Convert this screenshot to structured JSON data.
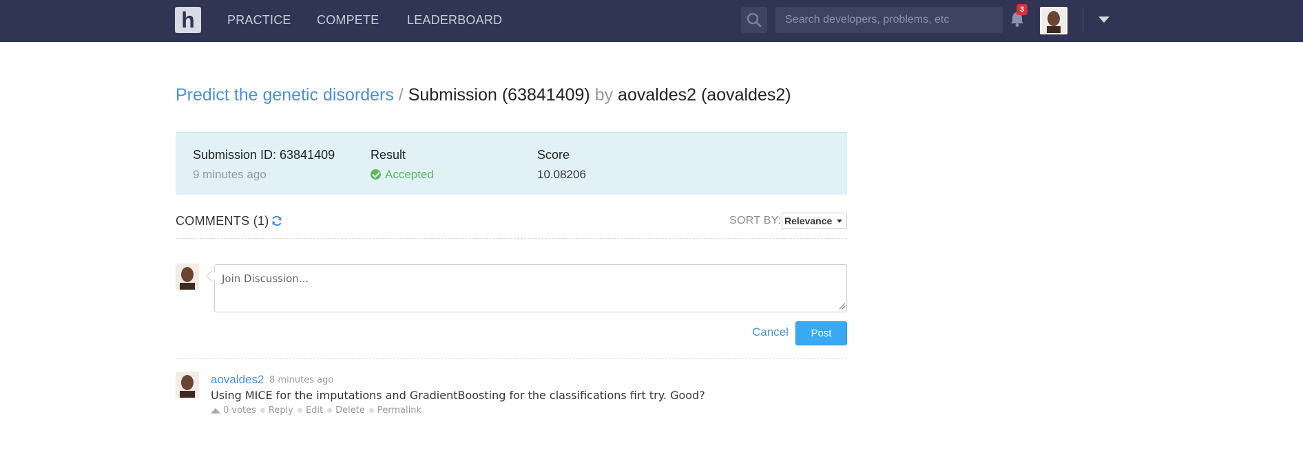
{
  "nav": {
    "logo": "h",
    "items": [
      "PRACTICE",
      "COMPETE",
      "LEADERBOARD"
    ],
    "search_placeholder": "Search developers, problems, etc",
    "notification_count": "3",
    "icons": [
      "search-icon",
      "bell-icon",
      "avatar",
      "chevron-down-icon"
    ]
  },
  "breadcrumb": {
    "problem": "Predict the genetic disorders",
    "separator": " / ",
    "submission": "Submission (63841409)",
    "by": " by ",
    "user": "aovaldes2 (aovaldes2)"
  },
  "submission": {
    "id_label": "Submission ID: 63841409",
    "time": "9 minutes ago",
    "result_label": "Result",
    "result_value": "Accepted",
    "score_label": "Score",
    "score_value": "10.08206"
  },
  "comments": {
    "title": "COMMENTS (1)",
    "sort_label": "SORT BY:",
    "sort_value": "Relevance",
    "compose_placeholder": "Join Discussion...",
    "cancel_label": "Cancel",
    "post_label": "Post",
    "items": [
      {
        "author": "aovaldes2",
        "time": "8 minutes ago",
        "body": "Using MICE for the imputations and GradientBoosting for the classifications firt try. Good?",
        "votes": "0 votes",
        "actions": [
          "Reply",
          "Edit",
          "Delete",
          "Permalink"
        ]
      }
    ]
  },
  "colors": {
    "topbar": "#2f3553",
    "link": "#4a90d9",
    "accepted": "#5cb85c",
    "panel": "#e1f1f6",
    "post_button": "#39a9f2"
  }
}
